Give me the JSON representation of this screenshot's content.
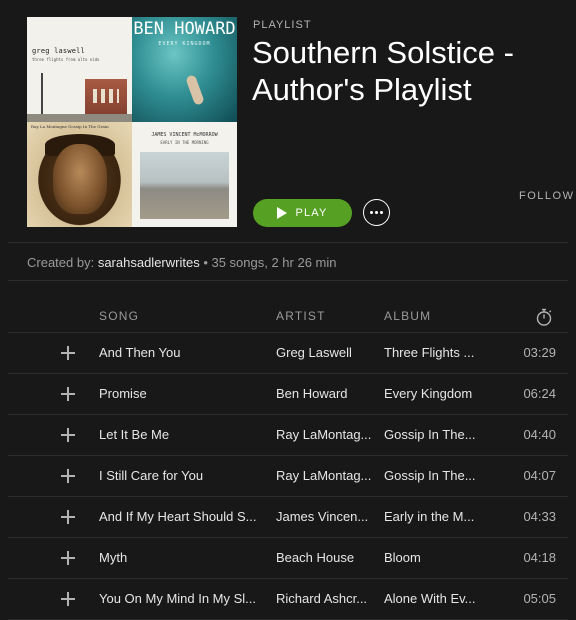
{
  "playlist": {
    "type_label": "PLAYLIST",
    "title": "Southern Solstice - Author's Playlist",
    "play_label": "PLAY",
    "follow_label": "FOLLOW",
    "created_prefix": "Created by:",
    "owner": "sarahsadlerwrites",
    "summary": " • 35 songs, 2 hr 26 min"
  },
  "cover": {
    "tile1_artist": "greg laswell",
    "tile1_album": "three flights from alto nido",
    "tile2_artist": "BEN HOWARD",
    "tile2_album": "EVERY KINGDOM",
    "tile3_caption": "Ray La Montagne    Gossip In The Grain",
    "tile4_artist": "JAMES VINCENT McMORROW",
    "tile4_album": "EARLY IN THE MORNING"
  },
  "table": {
    "headers": {
      "song": "SONG",
      "artist": "ARTIST",
      "album": "ALBUM"
    },
    "rows": [
      {
        "song": "And Then You",
        "artist": "Greg Laswell",
        "album": "Three Flights ...",
        "time": "03:29"
      },
      {
        "song": "Promise",
        "artist": "Ben Howard",
        "album": "Every Kingdom",
        "time": "06:24"
      },
      {
        "song": "Let It Be Me",
        "artist": "Ray LaMontag...",
        "album": "Gossip In The...",
        "time": "04:40"
      },
      {
        "song": "I Still Care for You",
        "artist": "Ray LaMontag...",
        "album": "Gossip In The...",
        "time": "04:07"
      },
      {
        "song": "And If My Heart Should S...",
        "artist": "James Vincen...",
        "album": "Early in the M...",
        "time": "04:33"
      },
      {
        "song": "Myth",
        "artist": "Beach House",
        "album": "Bloom",
        "time": "04:18"
      },
      {
        "song": "You On My Mind In My Sl...",
        "artist": "Richard Ashcr...",
        "album": "Alone With Ev...",
        "time": "05:05"
      }
    ]
  },
  "colors": {
    "background": "#181818",
    "play_green": "#56a024",
    "divider": "#2c2c2c",
    "muted_text": "#9a9a9a"
  },
  "icons": {
    "play": "play-icon",
    "more": "more-icon",
    "add": "plus-icon",
    "duration": "stopwatch-icon"
  }
}
